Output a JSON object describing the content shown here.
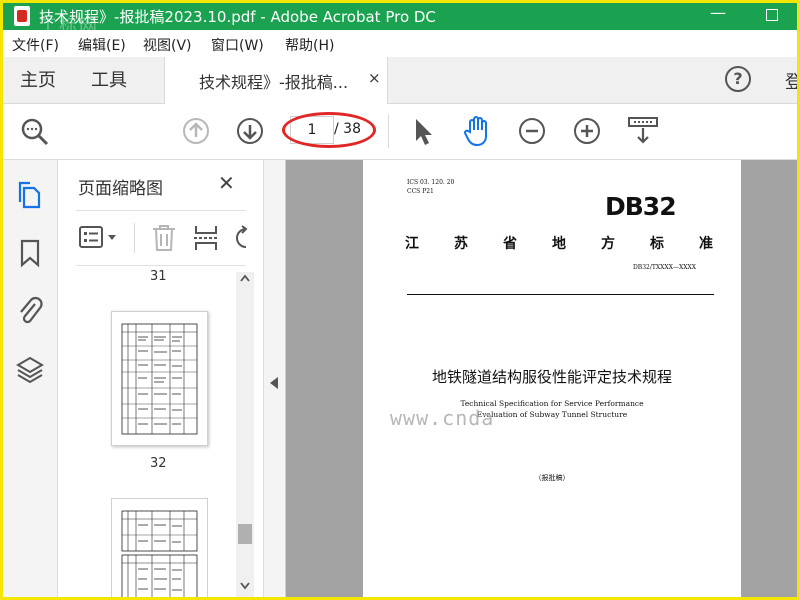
{
  "window": {
    "title": "技术规程》-报批稿2023.10.pdf - Adobe Acrobat Pro DC",
    "watermark_top": "工标网",
    "titlebar_color": "#1aa251"
  },
  "menu": {
    "items": [
      "文件(F)",
      "编辑(E)",
      "视图(V)",
      "窗口(W)",
      "帮助(H)"
    ]
  },
  "tabs": {
    "home": "主页",
    "tools": "工具",
    "doc_label": "技术规程》-报批稿...",
    "close_symbol": "×",
    "help_symbol": "?",
    "right_text": "登"
  },
  "toolbar": {
    "icons": [
      "search-icon",
      "previous-page-icon",
      "next-page-icon",
      "select-cursor-icon",
      "hand-tool-icon",
      "zoom-out-icon",
      "zoom-in-icon",
      "page-view-icon"
    ],
    "page_current": "1",
    "page_total": "/ 38",
    "annotation_color": "#e02626"
  },
  "left_rail": {
    "icons": [
      "page-thumbnails-icon",
      "bookmarks-icon",
      "attachments-icon",
      "layers-icon"
    ],
    "accent": "#1473e6"
  },
  "thumbnails_panel": {
    "title": "页面缩略图",
    "close_symbol": "✕",
    "tool_icons": [
      "thumbnail-options-icon",
      "delete-page-icon",
      "split-page-icon",
      "rotate-page-icon"
    ],
    "labels": [
      "31",
      "32"
    ]
  },
  "document": {
    "ics_line1": "ICS  03. 120. 20",
    "ics_line2": "CCS  P21",
    "logo": "DB32",
    "province": [
      "江",
      "苏",
      "省",
      "地",
      "方",
      "标",
      "准"
    ],
    "standard_no": "DB32/TXXXX—XXXX",
    "title_zh": "地铁隧道结构服役性能评定技术规程",
    "title_en_line1": "Technical Specification for Service Performance",
    "title_en_line2": "Evaluation of Subway Tunnel Structure",
    "draft_note": "（报批稿）"
  },
  "watermark_bottom": "www.cnda"
}
